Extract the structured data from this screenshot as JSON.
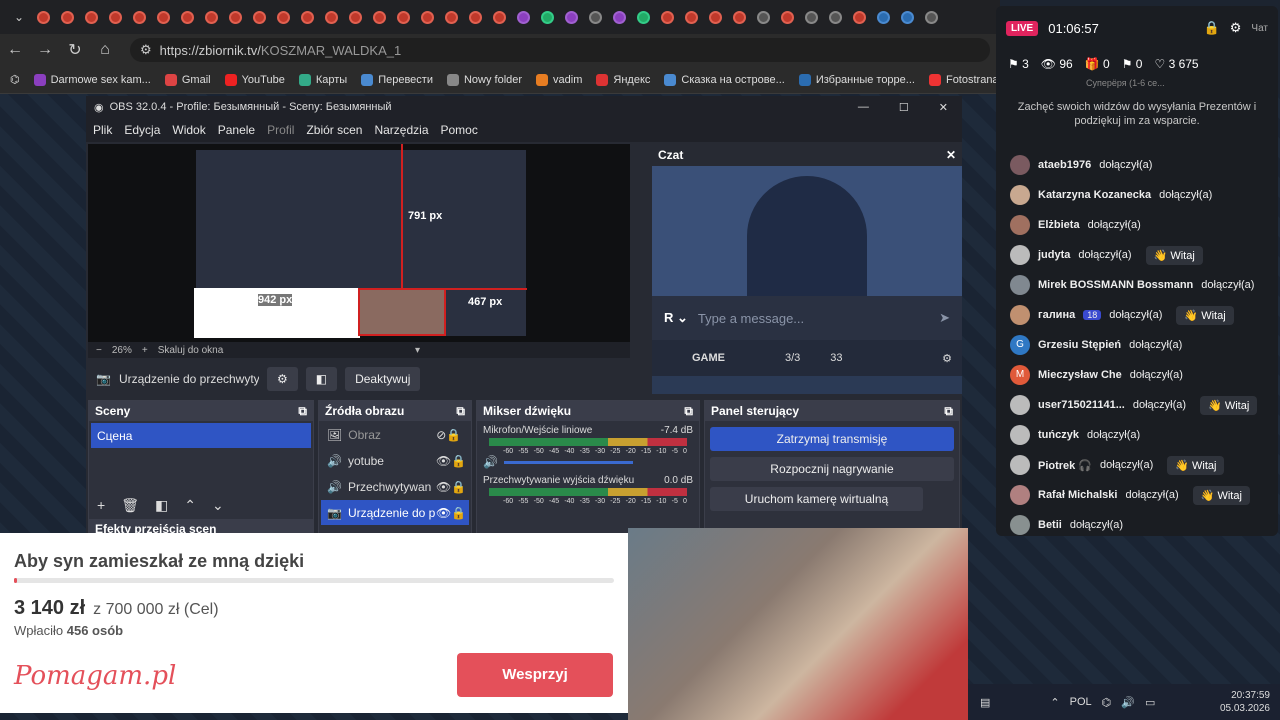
{
  "browser": {
    "url_host": "https://zbiornik.tv/",
    "url_path": "KOSZMAR_WALDKA_1",
    "bookmarks": [
      "Darmowe sex kam...",
      "Gmail",
      "YouTube",
      "Карты",
      "Перевести",
      "Nowy folder",
      "vadim",
      "Яндекс",
      "Сказка на острове...",
      "Избранные торре...",
      "Fotostrana - No Int..."
    ]
  },
  "obs": {
    "title": "OBS 32.0.4 - Profile: Безымянный - Sceny: Безымянный",
    "menu": [
      "Plik",
      "Edycja",
      "Widok",
      "Panele",
      "Profil",
      "Zbiór scen",
      "Narzędzia",
      "Pomoc"
    ],
    "preview_labels": {
      "px1": "791 px",
      "px2": "942 px",
      "px3": "467 px"
    },
    "zoom": "26%",
    "scale_mode": "Skaluj do okna",
    "source_name": "Urządzenie do przechwyty",
    "deactivate": "Deaktywuj",
    "chat_title": "Czat",
    "chat_placeholder": "Type a message...",
    "chat_game": "GAME",
    "chat_slots": "3/3",
    "chat_viewers": "33",
    "scenes_title": "Sceny",
    "scene_item": "Сцена",
    "transitions_title": "Efekty przejścia scen",
    "sources_title": "Źródła obrazu",
    "sources": [
      "Obraz",
      "yotube",
      "Przechwytywan",
      "Urządzenie do p"
    ],
    "mixer_title": "Mikser dźwięku",
    "mixer": [
      {
        "name": "Mikrofon/Wejście liniowe",
        "db": "-7.4 dB"
      },
      {
        "name": "Przechwytywanie wyjścia dźwięku",
        "db": "0.0 dB"
      }
    ],
    "mixer_scale": [
      "-60",
      "-55",
      "-50",
      "-45",
      "-40",
      "-35",
      "-30",
      "-25",
      "-20",
      "-15",
      "-10",
      "-5",
      "0"
    ],
    "controls_title": "Panel sterujący",
    "controls": [
      "Zatrzymaj transmisję",
      "Rozpocznij nagrywanie",
      "Uruchom kamerę wirtualną"
    ]
  },
  "rchat": {
    "live": "LIVE",
    "timer": "01:06:57",
    "chat_label": "Чат",
    "stats": [
      "3",
      "96",
      "0",
      "0",
      "3 675"
    ],
    "sub_names": "Суперёря (1-6 се...",
    "message": "Zachęć swoich widzów do wysyłania Prezentów i podziękuj im za wsparcie.",
    "joined_suffix": "dołączył(a)",
    "witaj": "Witaj",
    "badge": "18",
    "users": [
      {
        "name": "ataeb1976",
        "witaj": false,
        "color": "#7a5a60"
      },
      {
        "name": "Katarzyna Kozanecka",
        "witaj": false,
        "color": "#c8a890"
      },
      {
        "name": "Elżbieta",
        "witaj": false,
        "color": "#a07060"
      },
      {
        "name": "judyta",
        "witaj": true,
        "color": "#bbbbbb"
      },
      {
        "name": "Mirek BOSSMANN Bossmann",
        "witaj": false,
        "color": "#808890"
      },
      {
        "name": "галина",
        "witaj": true,
        "color": "#c09070",
        "badge": true
      },
      {
        "name": "Grzesiu Stępień",
        "witaj": false,
        "color": "#2f78c4",
        "letter": "G"
      },
      {
        "name": "Mieczysław Che",
        "witaj": false,
        "color": "#e05a3a",
        "letter": "M"
      },
      {
        "name": "user715021141...",
        "witaj": true,
        "color": "#bbbbbb"
      },
      {
        "name": "tuńczyk",
        "witaj": false,
        "color": "#bbbbbb"
      },
      {
        "name": "Piotrek 🎧",
        "witaj": true,
        "color": "#bbbbbb"
      },
      {
        "name": "Rafał Michalski",
        "witaj": true,
        "color": "#b08080"
      },
      {
        "name": "Betii",
        "witaj": false,
        "color": "#889090"
      }
    ]
  },
  "donation": {
    "title": "Aby syn zamieszkał ze mną dzięki",
    "amount": "3 140 zł",
    "goal": "z 700 000 zł (Cel)",
    "paid_label": "Wpłaciło",
    "paid_count": "456 osób",
    "logo": "Pomagam.pl",
    "button": "Wesprzyj"
  },
  "taskbar": {
    "lang": "POL",
    "time": "20:37:59",
    "date": "05.03.2026"
  }
}
